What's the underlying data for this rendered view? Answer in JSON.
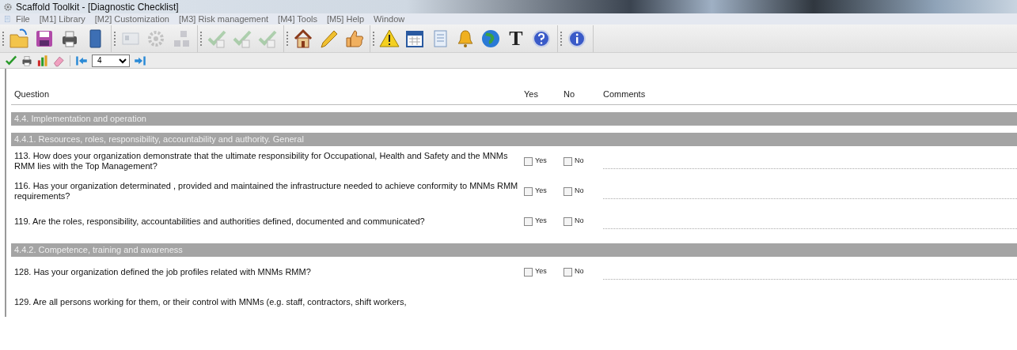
{
  "window": {
    "title": "Scaffold Toolkit - [Diagnostic Checklist]"
  },
  "menu": [
    "File",
    "[M1] Library",
    "[M2] Customization",
    "[M3] Risk management",
    "[M4] Tools",
    "[M5] Help",
    "Window"
  ],
  "toolbar_main": [
    [
      {
        "kind": "folder",
        "disabled": false
      },
      {
        "kind": "save",
        "disabled": false
      },
      {
        "kind": "print",
        "disabled": false
      },
      {
        "kind": "book",
        "disabled": false
      }
    ],
    [
      {
        "kind": "card",
        "disabled": true
      },
      {
        "kind": "gear",
        "disabled": true
      },
      {
        "kind": "blocks",
        "disabled": true
      }
    ],
    [
      {
        "kind": "check",
        "disabled": true
      },
      {
        "kind": "check",
        "disabled": true
      },
      {
        "kind": "check",
        "disabled": true
      }
    ],
    [
      {
        "kind": "house",
        "disabled": false
      },
      {
        "kind": "pencil",
        "disabled": false
      },
      {
        "kind": "thumb",
        "disabled": false
      }
    ],
    [
      {
        "kind": "warning",
        "disabled": false
      },
      {
        "kind": "calendar",
        "disabled": false
      },
      {
        "kind": "document",
        "disabled": false
      },
      {
        "kind": "bell",
        "disabled": false
      },
      {
        "kind": "globe",
        "disabled": false
      },
      {
        "kind": "letter",
        "label": "T",
        "disabled": false
      },
      {
        "kind": "help",
        "disabled": false
      }
    ],
    [
      {
        "kind": "info",
        "disabled": false
      }
    ]
  ],
  "toolbar_secondary": {
    "left": [
      {
        "kind": "tick"
      },
      {
        "kind": "print"
      },
      {
        "kind": "chart"
      },
      {
        "kind": "eraser"
      }
    ],
    "page_select": {
      "value": "4"
    }
  },
  "table": {
    "columns": [
      "Question",
      "Yes",
      "No",
      "Comments"
    ],
    "rows": [
      {
        "kind": "section",
        "text": "4.4. Implementation and operation"
      },
      {
        "kind": "section",
        "text": "4.4.1. Resources, roles, responsibility, accountability and authority. General"
      },
      {
        "kind": "question",
        "text": "113. How does your organization demonstrate that the ultimate responsibility for Occupational, Health and Safety and the MNMs RMM lies with the Top Management?",
        "yes_label": "Yes",
        "no_label": "No",
        "yes": false,
        "no": false
      },
      {
        "kind": "question",
        "text": "116. Has your organization determinated , provided and maintained the infrastructure needed to achieve conformity to MNMs RMM requirements?",
        "yes_label": "Yes",
        "no_label": "No",
        "yes": false,
        "no": false
      },
      {
        "kind": "question",
        "text": "119. Are the roles, responsibility, accountabilities and authorities defined, documented and communicated?",
        "yes_label": "Yes",
        "no_label": "No",
        "yes": false,
        "no": false
      },
      {
        "kind": "section",
        "text": "4.4.2. Competence, training and awareness"
      },
      {
        "kind": "question",
        "text": "128. Has your organization defined the job profiles related with MNMs RMM?",
        "yes_label": "Yes",
        "no_label": "No",
        "yes": false,
        "no": false
      },
      {
        "kind": "question",
        "text": "129. Are all persons working for them, or their control with MNMs (e.g. staff, contractors, shift workers,"
      }
    ]
  }
}
